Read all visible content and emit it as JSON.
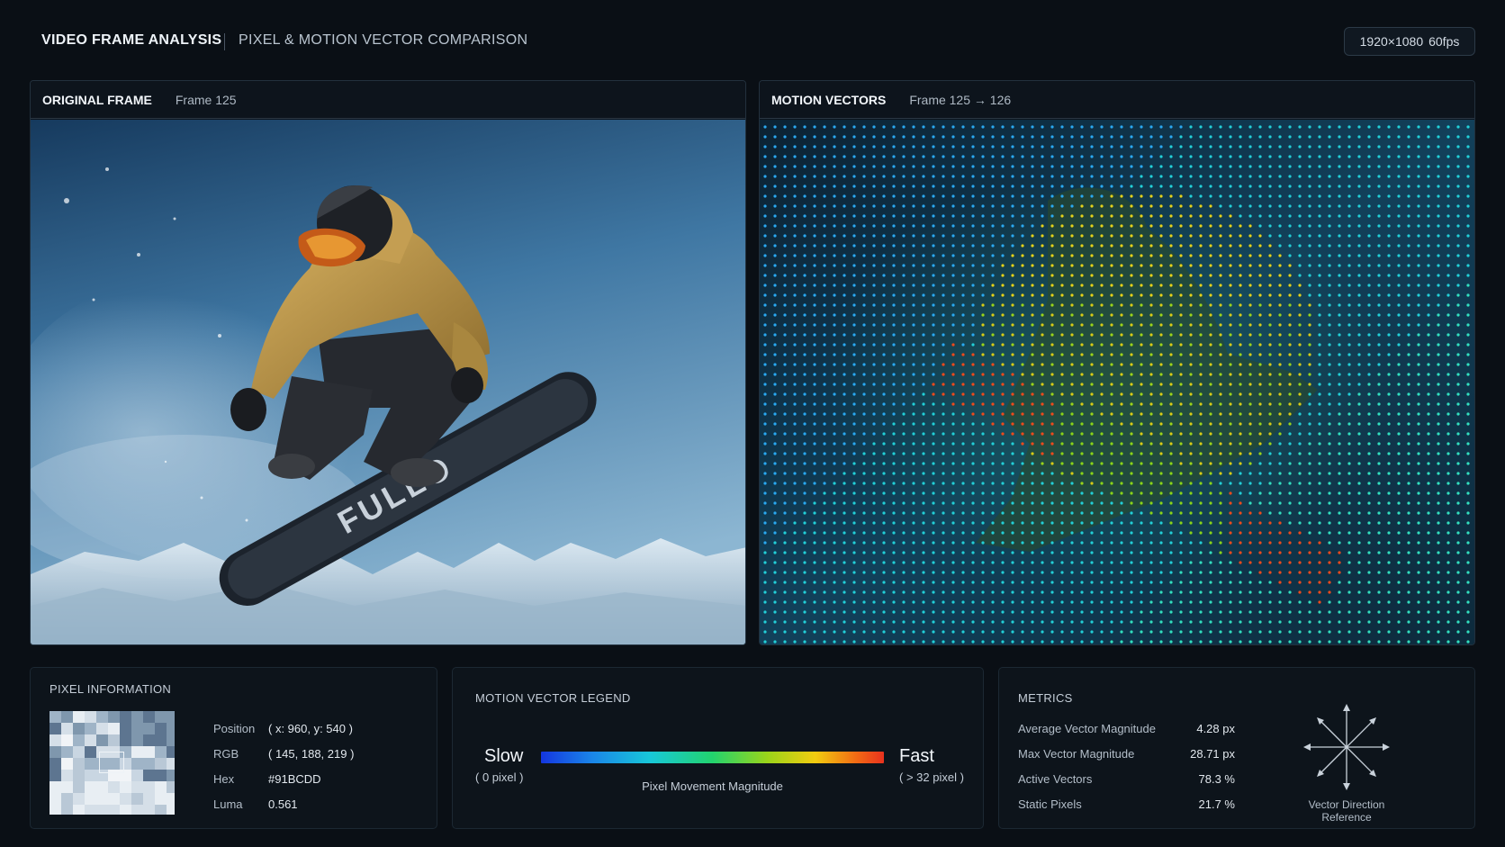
{
  "header": {
    "title": "VIDEO FRAME ANALYSIS",
    "subtitle": "PIXEL & MOTION VECTOR COMPARISON",
    "resolution": "1920×1080",
    "fps": "60fps"
  },
  "original_panel": {
    "title": "ORIGINAL FRAME",
    "frame_label": "Frame 125",
    "board_text": "FULLO"
  },
  "motion_panel": {
    "title": "MOTION VECTORS",
    "frame_label": "Frame 125 → 126"
  },
  "pixel_info": {
    "title": "PIXEL INFORMATION",
    "rows": [
      {
        "label": "Position",
        "value": "( x: 960, y: 540 )"
      },
      {
        "label": "RGB",
        "value": "( 145, 188, 219 )"
      },
      {
        "label": "Hex",
        "value": "#91BCDD"
      },
      {
        "label": "Luma",
        "value": "0.561"
      }
    ]
  },
  "legend": {
    "title": "MOTION VECTOR LEGEND",
    "slow_label": "Slow",
    "slow_sub": "( 0 pixel )",
    "fast_label": "Fast",
    "fast_sub": "( > 32 pixel )",
    "caption": "Pixel Movement Magnitude"
  },
  "metrics": {
    "title": "METRICS",
    "rows": [
      {
        "label": "Average Vector Magnitude",
        "value": "4.28 px"
      },
      {
        "label": "Max Vector Magnitude",
        "value": "28.71 px"
      },
      {
        "label": "Active Vectors",
        "value": "78.3 %"
      },
      {
        "label": "Static Pixels",
        "value": "21.7 %"
      }
    ],
    "direction_caption": "Vector Direction Reference"
  },
  "colors": {
    "background": "#0a0f15",
    "panel": "#0e151d",
    "sky": "#4a82ad",
    "jacket": "#b8964a",
    "slow": "#1436e0",
    "fast": "#e8321e"
  }
}
